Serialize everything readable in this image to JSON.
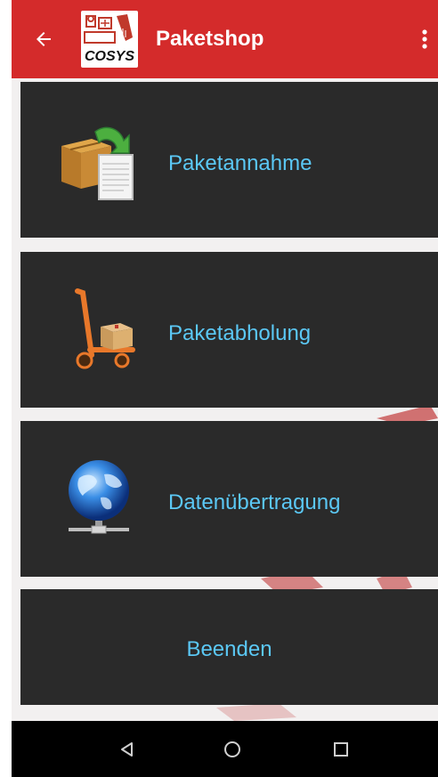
{
  "app_bar": {
    "title": "Paketshop",
    "back_icon": "arrow-back-icon",
    "overflow_icon": "more-vert-icon",
    "logo_icon": "cosys-logo-icon",
    "logo_text": "COSYS",
    "background_color": "#d42b2b"
  },
  "menu": {
    "tile_background": "#2a2a2a",
    "label_color": "#5bc8f5",
    "items": [
      {
        "label": "Paketannahme",
        "icon": "package-receive-icon"
      },
      {
        "label": "Paketabholung",
        "icon": "hand-truck-icon"
      },
      {
        "label": "Datenübertragung",
        "icon": "network-globe-icon"
      },
      {
        "label": "Beenden"
      }
    ]
  },
  "nav_bar": {
    "back_icon": "nav-back-icon",
    "home_icon": "nav-home-icon",
    "recents_icon": "nav-recents-icon"
  }
}
